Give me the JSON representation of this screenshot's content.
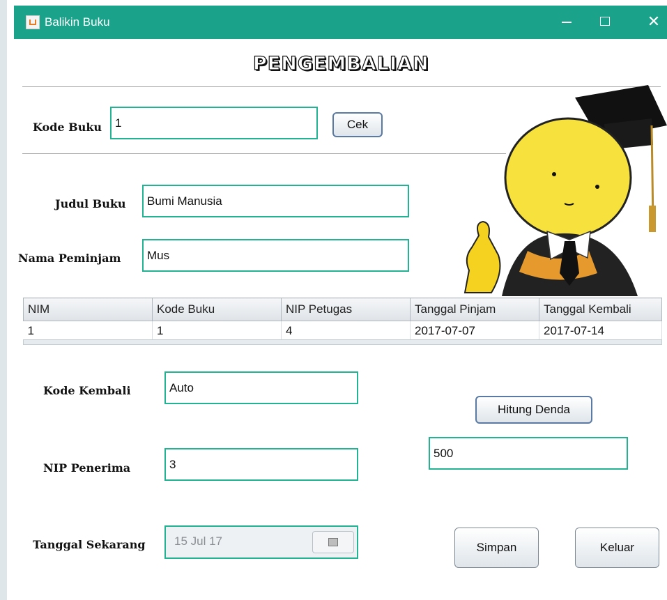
{
  "window": {
    "title": "Balikin Buku"
  },
  "heading": "PENGEMBALIAN",
  "kode_buku": {
    "label": "Kode Buku",
    "value": "1",
    "button": "Cek"
  },
  "judul_buku": {
    "label": "Judul Buku",
    "value": "Bumi Manusia"
  },
  "nama_peminjam": {
    "label": "Nama Peminjam",
    "value": "Mus"
  },
  "table": {
    "columns": [
      "NIM",
      "Kode Buku",
      "NIP Petugas",
      "Tanggal Pinjam",
      "Tanggal Kembali"
    ],
    "rows": [
      [
        "1",
        "1",
        "4",
        "2017-07-07",
        "2017-07-14"
      ]
    ]
  },
  "kode_kembali": {
    "label": "Kode Kembali",
    "value": "Auto"
  },
  "nip_penerima": {
    "label": "NIP Penerima",
    "value": "3"
  },
  "tanggal_sekarang": {
    "label": "Tanggal Sekarang",
    "value": "15 Jul 17"
  },
  "hitung_denda": {
    "button": "Hitung Denda",
    "value": "500"
  },
  "actions": {
    "simpan": "Simpan",
    "keluar": "Keluar"
  },
  "colors": {
    "titlebar": "#1aa38a",
    "field_border": "#24b392"
  },
  "icons": {
    "app": "java-icon",
    "minimize": "minimize-icon",
    "maximize": "maximize-icon",
    "close": "close-icon",
    "calendar": "calendar-icon"
  }
}
